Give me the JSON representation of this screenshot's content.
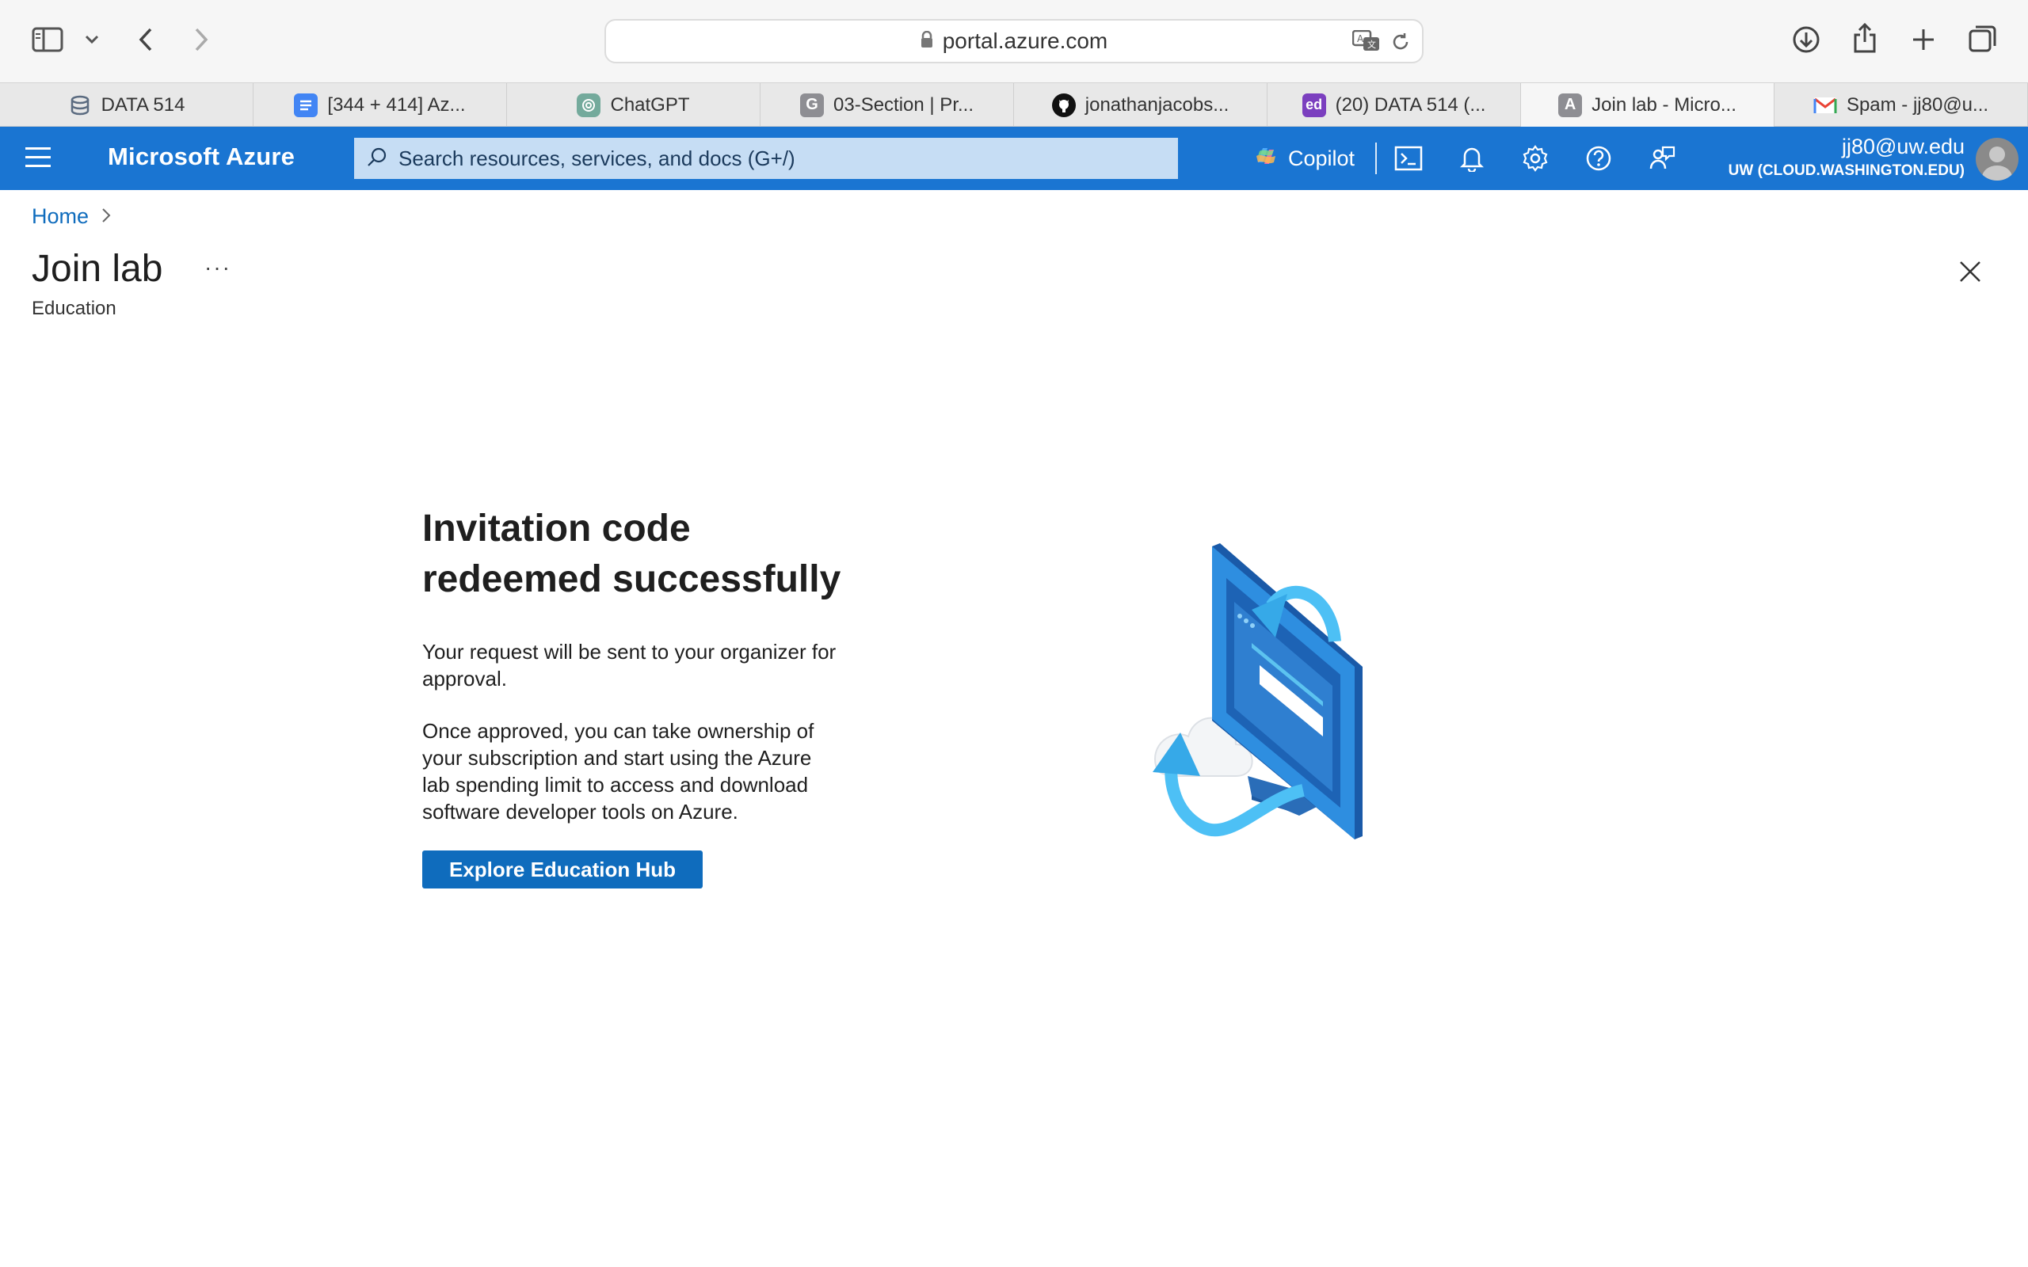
{
  "browser": {
    "url": "portal.azure.com",
    "tabs": [
      {
        "label": "DATA 514",
        "icon": "database-icon",
        "active": false
      },
      {
        "label": "[344 + 414] Az...",
        "icon": "docs-icon",
        "active": false
      },
      {
        "label": "ChatGPT",
        "icon": "chatgpt-icon",
        "active": false
      },
      {
        "label": "03-Section | Pr...",
        "icon": "g-icon",
        "active": false
      },
      {
        "label": "jonathanjacobs...",
        "icon": "github-icon",
        "active": false
      },
      {
        "label": "(20) DATA 514 (...",
        "icon": "ed-icon",
        "active": false
      },
      {
        "label": "Join lab - Micro...",
        "icon": "azure-a-icon",
        "active": true
      },
      {
        "label": "Spam - jj80@u...",
        "icon": "gmail-icon",
        "active": false
      }
    ],
    "tab_badges": {
      "g": "G",
      "ed": "ed",
      "a": "A"
    }
  },
  "azure": {
    "brand": "Microsoft Azure",
    "search_placeholder": "Search resources, services, and docs (G+/)",
    "copilot_label": "Copilot",
    "account_email": "jj80@uw.edu",
    "account_tenant": "UW (CLOUD.WASHINGTON.EDU)"
  },
  "page": {
    "breadcrumb_home": "Home",
    "title": "Join lab",
    "more": "···",
    "subtitle": "Education",
    "headline": "Invitation code redeemed successfully",
    "para1": "Your request will be sent to your organizer for approval.",
    "para2": "Once approved, you can take ownership of your subscription and start using the Azure lab spending limit to access and download software developer tools on Azure.",
    "button": "Explore Education Hub"
  },
  "colors": {
    "azure_header": "#1a75d2",
    "primary_button": "#0f6cbd",
    "search_bg": "#c6ddf4"
  }
}
